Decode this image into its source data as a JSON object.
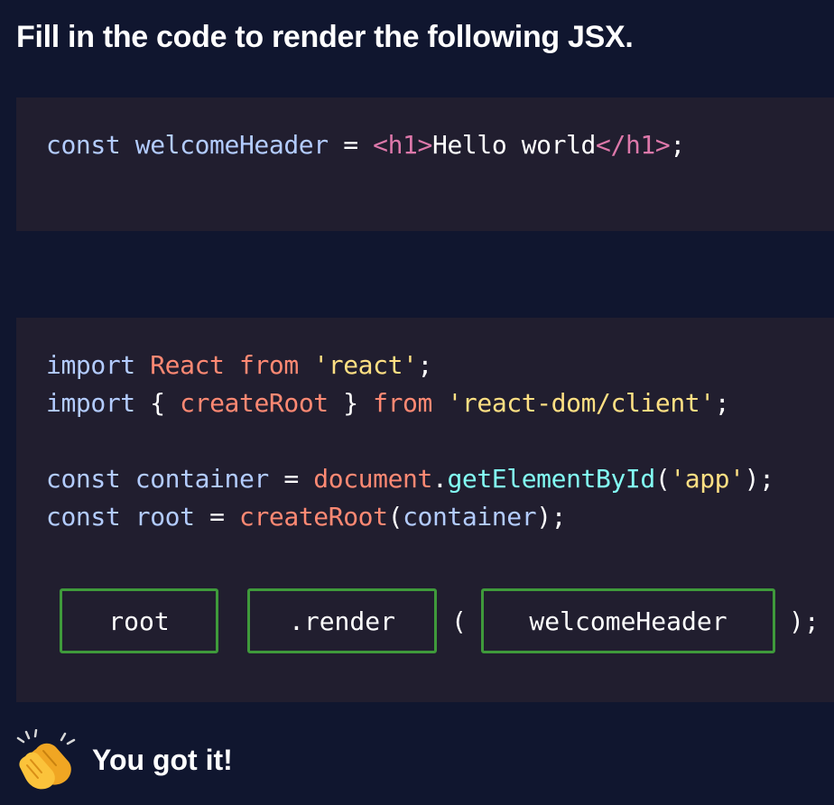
{
  "title": "Fill in the code to render the following JSX.",
  "snippet1": {
    "kw_const": "const",
    "var_name": "welcomeHeader",
    "equals": "=",
    "open_tag_lt": "<",
    "open_tag_name": "h1",
    "open_tag_gt": ">",
    "text": "Hello world",
    "close_tag_lt": "</",
    "close_tag_name": "h1",
    "close_tag_gt": ">",
    "semicolon": ";"
  },
  "snippet2": {
    "line1": {
      "kw": "import",
      "ident": "React",
      "from": "from",
      "str": "'react'",
      "semi": ";"
    },
    "line2": {
      "kw": "import",
      "brace_open": "{",
      "ident": "createRoot",
      "brace_close": "}",
      "from": "from",
      "str": "'react-dom/client'",
      "semi": ";"
    },
    "line3": {
      "kw": "const",
      "ident": "container",
      "eq": "=",
      "obj": "document",
      "dot": ".",
      "method": "getElementById",
      "paren_open": "(",
      "str": "'app'",
      "paren_close": ")",
      "semi": ";"
    },
    "line4": {
      "kw": "const",
      "ident": "root",
      "eq": "=",
      "fn": "createRoot",
      "paren_open": "(",
      "arg": "container",
      "paren_close": ")",
      "semi": ";"
    }
  },
  "answer": {
    "slot1": "root",
    "slot2": ".render",
    "paren_open": "(",
    "slot3": "welcomeHeader",
    "paren_close_semi": ");"
  },
  "feedback": {
    "icon": "clapping-hands-icon",
    "text": "You got it!"
  },
  "colors": {
    "background": "#10162f",
    "code_bg": "#211e2f",
    "slot_border": "#3f9a3b"
  }
}
